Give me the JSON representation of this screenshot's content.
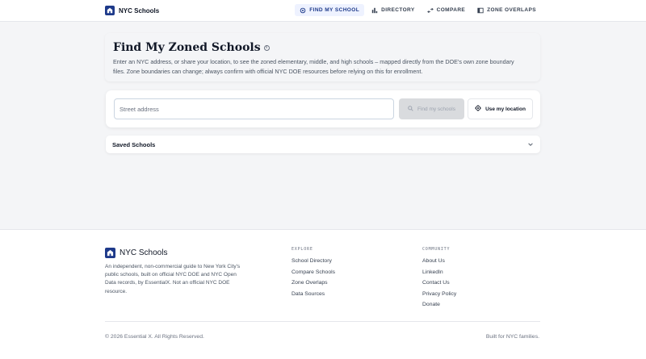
{
  "header": {
    "brand": "NYC Schools",
    "nav": [
      {
        "label": "FIND MY SCHOOL",
        "icon": "crosshair-icon",
        "active": true
      },
      {
        "label": "DIRECTORY",
        "icon": "bar-chart-icon",
        "active": false
      },
      {
        "label": "COMPARE",
        "icon": "compare-arrows-icon",
        "active": false
      },
      {
        "label": "ZONE OVERLAPS",
        "icon": "map-icon",
        "active": false
      }
    ]
  },
  "hero": {
    "title": "Find My Zoned Schools",
    "description": "Enter an NYC address, or share your location, to see the zoned elementary, middle, and high schools – mapped directly from the DOE's own zone boundary files. Zone boundaries can change; always confirm with official NYC DOE resources before relying on this for enrollment."
  },
  "search": {
    "placeholder": "Street address",
    "value": "",
    "find_label": "Find my schools",
    "location_label": "Use my location"
  },
  "saved": {
    "label": "Saved Schools"
  },
  "footer": {
    "brand": "NYC Schools",
    "description": "An independent, non-commercial guide to New York City's public schools, built on official NYC DOE and NYC Open Data records, by EssentialX. Not an official NYC DOE resource.",
    "explore": {
      "title": "EXPLORE",
      "links": [
        "School Directory",
        "Compare Schools",
        "Zone Overlaps",
        "Data Sources"
      ]
    },
    "community": {
      "title": "COMMUNITY",
      "links": [
        "About Us",
        "LinkedIn",
        "Contact Us",
        "Privacy Policy",
        "Donate"
      ]
    },
    "copyright": "© 2026 Essential X. All Rights Reserved.",
    "built_for": "Built for NYC families."
  },
  "colors": {
    "brand": "#1e3a8a",
    "active_nav_bg": "#eef2ff",
    "page_bg": "#f4f5f7"
  }
}
